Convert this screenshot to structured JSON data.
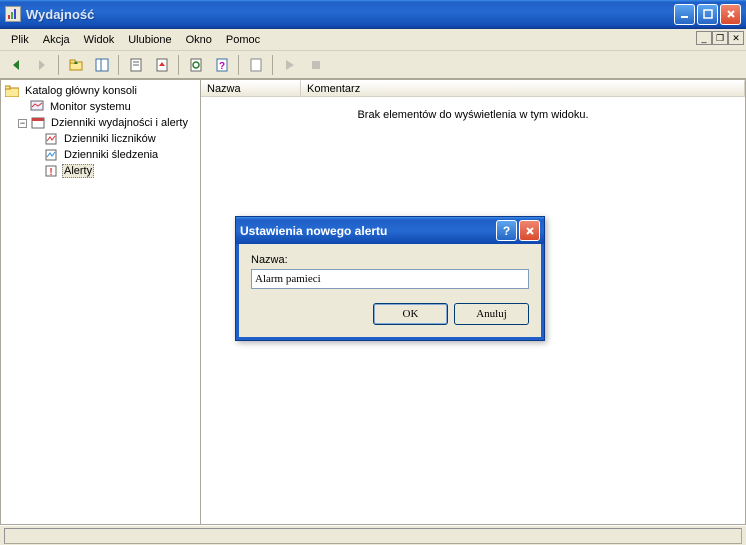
{
  "window": {
    "title": "Wydajność"
  },
  "menubar": {
    "items": [
      "Plik",
      "Akcja",
      "Widok",
      "Ulubione",
      "Okno",
      "Pomoc"
    ]
  },
  "tree": {
    "root": "Katalog główny konsoli",
    "monitor": "Monitor systemu",
    "logs": "Dzienniki wydajności i alerty",
    "counters": "Dzienniki liczników",
    "trace": "Dzienniki śledzenia",
    "alerts": "Alerty"
  },
  "list": {
    "columns": [
      "Nazwa",
      "Komentarz"
    ],
    "empty": "Brak elementów do wyświetlenia w tym widoku."
  },
  "dialog": {
    "title": "Ustawienia nowego alertu",
    "name_label": "Nazwa:",
    "name_value": "Alarm pamieci",
    "ok": "OK",
    "cancel": "Anuluj"
  }
}
